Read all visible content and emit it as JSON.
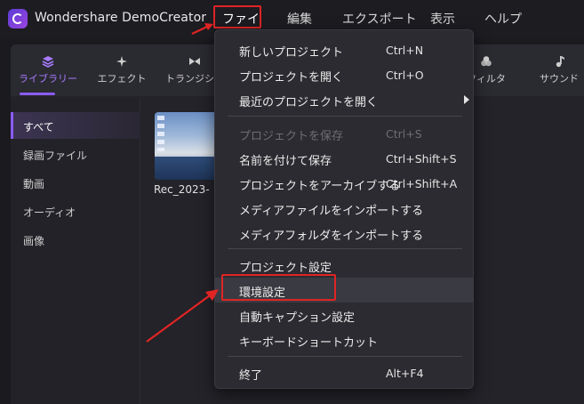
{
  "app": {
    "title": "Wondershare DemoCreator"
  },
  "menubar": {
    "items": [
      {
        "label": "ファイル"
      },
      {
        "label": "編集"
      },
      {
        "label": "エクスポート"
      },
      {
        "label": "表示"
      },
      {
        "label": "ヘルプ"
      }
    ]
  },
  "tabs": [
    {
      "label": "ライブラリー",
      "icon": "layers-icon",
      "active": true
    },
    {
      "label": "エフェクト",
      "icon": "sparkle-icon"
    },
    {
      "label": "トランジショ",
      "icon": "transition-icon"
    },
    {
      "label": "フィルタ",
      "icon": "filter-icon"
    },
    {
      "label": "サウンド",
      "icon": "music-note-icon"
    }
  ],
  "sidebar": {
    "items": [
      {
        "label": "すべて",
        "active": true
      },
      {
        "label": "録画ファイル"
      },
      {
        "label": "動画"
      },
      {
        "label": "オーディオ"
      },
      {
        "label": "画像"
      }
    ]
  },
  "media": {
    "clip_name": "Rec_2023-"
  },
  "file_menu": {
    "items": [
      {
        "label": "新しいプロジェクト",
        "shortcut": "Ctrl+N"
      },
      {
        "label": "プロジェクトを開く",
        "shortcut": "Ctrl+O"
      },
      {
        "label": "最近のプロジェクトを開く",
        "shortcut": "",
        "submenu": true
      },
      {
        "label": "プロジェクトを保存",
        "shortcut": "Ctrl+S",
        "disabled": true
      },
      {
        "label": "名前を付けて保存",
        "shortcut": "Ctrl+Shift+S"
      },
      {
        "label": "プロジェクトをアーカイブする",
        "shortcut": "Ctrl+Shift+A"
      },
      {
        "label": "メディアファイルをインポートする",
        "shortcut": ""
      },
      {
        "label": "メディアフォルダをインポートする",
        "shortcut": ""
      },
      {
        "label": "プロジェクト設定",
        "shortcut": ""
      },
      {
        "label": "環境設定",
        "shortcut": "",
        "highlighted": true
      },
      {
        "label": "自動キャプション設定",
        "shortcut": ""
      },
      {
        "label": "キーボードショートカット",
        "shortcut": ""
      },
      {
        "label": "終了",
        "shortcut": "Alt+F4"
      }
    ]
  },
  "colors": {
    "accent": "#8c5cf5",
    "annotation": "#e02424",
    "menu_bg": "#2b2b31",
    "app_bg": "#1a1a1f"
  }
}
